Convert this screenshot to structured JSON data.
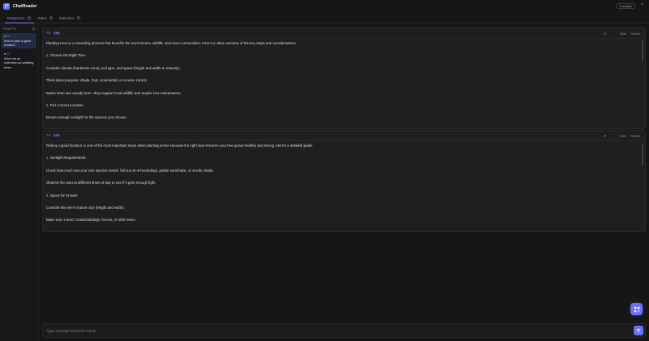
{
  "app": {
    "title": "ChatReader",
    "prompts_pill": "2 prompts",
    "close_label": "×"
  },
  "tabs": [
    {
      "label": "Responses",
      "count": "2"
    },
    {
      "label": "Notes",
      "count": "0"
    },
    {
      "label": "Branches",
      "count": "0"
    }
  ],
  "sidebar": {
    "heading": "PROMPTS",
    "add_label": "+",
    "items": [
      {
        "num": "P2",
        "text": "how to pick a good location"
      },
      {
        "num": "P1",
        "text": "Give me an overview on planting trees"
      }
    ]
  },
  "cards": [
    {
      "prompt": "P1",
      "badge": "Last",
      "filter_icon": "▼",
      "note_label": "Note",
      "branch_label": "Branch",
      "lines": [
        "Planting trees is a rewarding process that benefits the environment, wildlife, and even communities. Here's a clear overview of the key steps and considerations:",
        "1. Choose the Right Tree",
        "Consider climate (hardiness zone), soil type, and space (height and width at maturity).",
        "Think about purpose: shade, fruit, ornamental, or erosion control.",
        "Native trees are usually best—they support local wildlife and require less maintenance.",
        "2. Pick a Good Location",
        "Ensure enough sunlight for the species you choose."
      ]
    },
    {
      "prompt": "P1",
      "badge": "Last",
      "filter_icon": "▼",
      "note_label": "Note",
      "branch_label": "Branch",
      "lines": [
        "Picking a good location is one of the most important steps when planting a tree because the right spot ensures your tree grows healthy and strong. Here's a detailed guide:",
        "1. Sunlight Requirements",
        "Check how much sun your tree species needs: full sun (6–8 hours/day), partial sun/shade, or mostly shade.",
        "Observe the area at different times of day to see if it gets enough light.",
        "2. Space for Growth",
        "Consider the tree's mature size (height and width).",
        "Make sure it won't crowd buildings, fences, or other trees."
      ]
    }
  ],
  "composer": {
    "placeholder": "Type a prompt and press Send..."
  },
  "colors": {
    "accent": "#6b72f2",
    "background": "#161617",
    "card": "#1f1f21",
    "status_dot": "#3ccb7f"
  }
}
